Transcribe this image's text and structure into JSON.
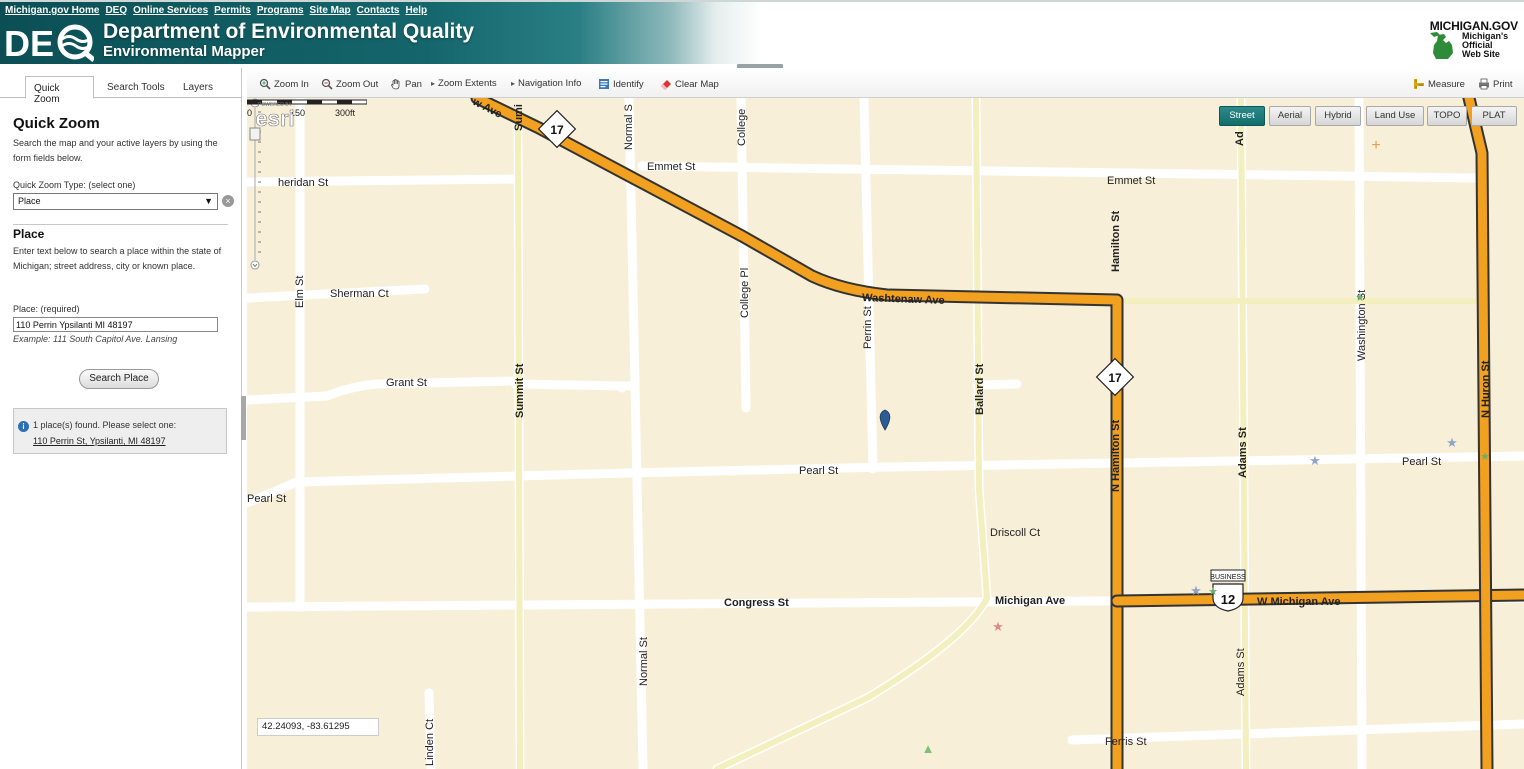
{
  "header": {
    "nav": [
      "Michigan.gov Home",
      "DEQ",
      "Online Services",
      "Permits",
      "Programs",
      "Site Map",
      "Contacts",
      "Help"
    ],
    "title": "Department of Environmental Quality",
    "subtitle": "Environmental Mapper",
    "logo_text": "DEQ",
    "michigan_gov": "MICHIGAN.GOV",
    "official_line1": "Michigan's",
    "official_line2": "Official",
    "official_line3": "Web Site"
  },
  "sidebar": {
    "tabs": [
      "Quick Zoom",
      "Search Tools",
      "Layers"
    ],
    "active_tab": "Quick Zoom",
    "title": "Quick Zoom",
    "description": "Search the map and your active layers by using the form fields below.",
    "type_label": "Quick Zoom Type: (select one)",
    "type_value": "Place",
    "place_title": "Place",
    "place_description": "Enter text below to search a place within the state of Michigan; street address, city or known place.",
    "place_label": "Place: (required)",
    "place_value": "110 Perrin Ypsilanti MI 48197",
    "example": "Example: 111 South Capitol Ave. Lansing",
    "search_button": "Search Place",
    "result_text": "1 place(s) found. Please select one:",
    "result_link": "110 Perrin St, Ypsilanti, MI 48197"
  },
  "toolbar": {
    "zoom_in": "Zoom In",
    "zoom_out": "Zoom Out",
    "pan": "Pan",
    "zoom_extents": "Zoom Extents",
    "navigation_info": "Navigation Info",
    "identify": "Identify",
    "clear_map": "Clear Map",
    "measure": "Measure",
    "print": "Print"
  },
  "map_types": [
    "Street",
    "Aerial",
    "Hybrid",
    "Land Use",
    "TOPO",
    "PLAT"
  ],
  "active_map_type": "Street",
  "map": {
    "coordinates": "42.24093, -83.61295",
    "scale_labels": [
      "0",
      "150",
      "300ft"
    ],
    "streets": {
      "washtenaw_top": "w Ave",
      "summit_top": "Sumi",
      "normal_top": "Normal S",
      "college_top": "College",
      "emmet1": "Emmet St",
      "emmet2": "Emmet St",
      "sheridan": "heridan St",
      "hamilton": "Hamilton St",
      "adams_top": "Ad",
      "sherman": "Sherman Ct",
      "elm": "Elm St",
      "college_pl": "College Pl",
      "washtenaw": "Washtenaw Ave",
      "perrin": "Perrin St",
      "washington": "Washington St",
      "huron": "N Huron St",
      "grant": "Grant St",
      "summit": "Summit St",
      "ballard": "Ballard St",
      "n_hamilton": "N Hamilton St",
      "adams": "Adams St",
      "pearl1": "Pearl St",
      "pearl2": "Pearl St",
      "pearl3": "Pearl St",
      "driscoll": "Driscoll Ct",
      "congress": "Congress St",
      "michigan_ave": "Michigan Ave",
      "w_michigan": "W Michigan Ave",
      "normal": "Normal St",
      "adams_bottom": "Adams St",
      "linden": "Linden Ct",
      "ferris": "Ferris St"
    },
    "shields": {
      "route17_a": "17",
      "route17_b": "17",
      "us12": "12",
      "business": "BUSINESS"
    },
    "attribution": "esri"
  }
}
